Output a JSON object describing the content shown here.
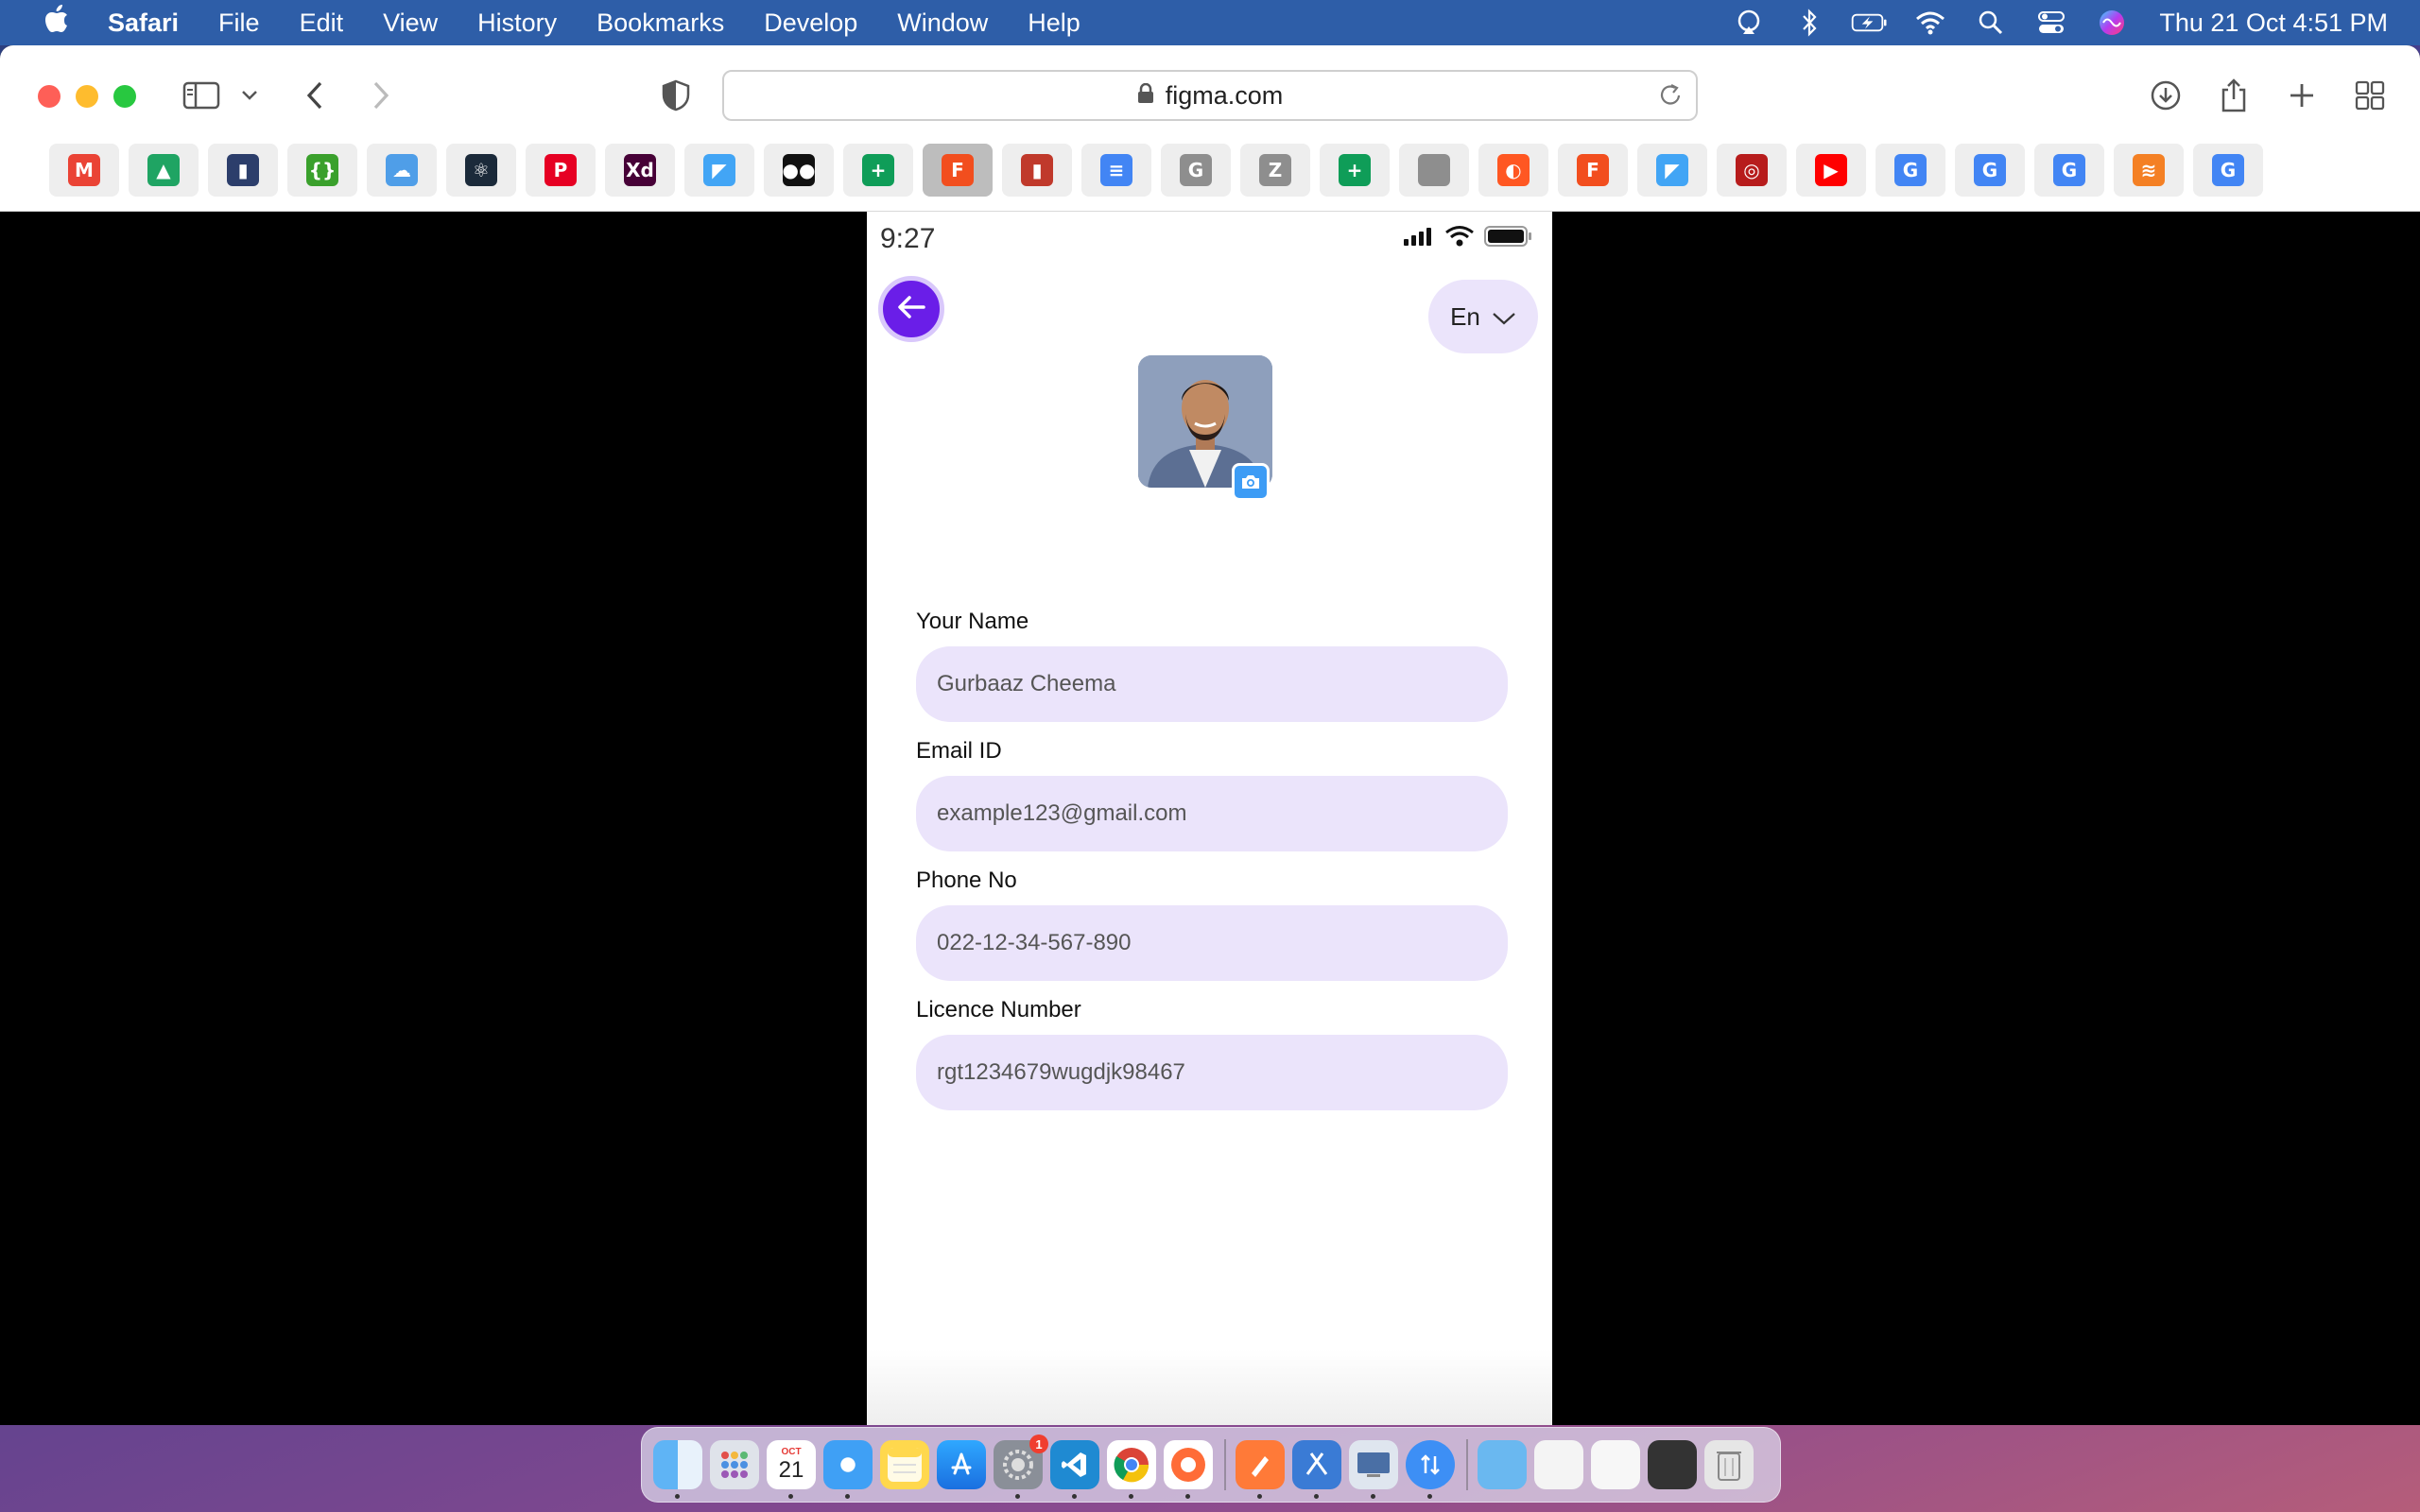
{
  "menubar": {
    "app_name": "Safari",
    "menus": [
      "File",
      "Edit",
      "View",
      "History",
      "Bookmarks",
      "Develop",
      "Window",
      "Help"
    ],
    "clock": "Thu 21 Oct  4:51 PM",
    "status_icons": [
      "airplay-icon",
      "bluetooth-icon",
      "battery-charging-icon",
      "wifi-icon",
      "spotlight-search-icon",
      "control-center-icon",
      "siri-icon"
    ]
  },
  "browser": {
    "url": "figma.com",
    "favorites": [
      {
        "name": "gmail",
        "glyph": "M",
        "color": "#ea4335"
      },
      {
        "name": "google-drive",
        "glyph": "▲",
        "color": "#1fa463"
      },
      {
        "name": "bookmark-app",
        "glyph": "▮",
        "color": "#2c3e6b"
      },
      {
        "name": "api-tool",
        "glyph": "{}",
        "color": "#3aa02c"
      },
      {
        "name": "icloud",
        "glyph": "☁",
        "color": "#4f9ee8"
      },
      {
        "name": "react",
        "glyph": "⚛",
        "color": "#1b2a3a"
      },
      {
        "name": "pinterest",
        "glyph": "P",
        "color": "#e60023"
      },
      {
        "name": "adobe-xd",
        "glyph": "Xd",
        "color": "#470137"
      },
      {
        "name": "flutter",
        "glyph": "◤",
        "color": "#42a5f5"
      },
      {
        "name": "medium",
        "glyph": "●●",
        "color": "#111111"
      },
      {
        "name": "google-sheets",
        "glyph": "+",
        "color": "#0f9d58"
      },
      {
        "name": "figma",
        "glyph": "F",
        "color": "#f24e1e"
      },
      {
        "name": "analytics",
        "glyph": "▮",
        "color": "#c0392b"
      },
      {
        "name": "google-docs",
        "glyph": "≡",
        "color": "#4285f4"
      },
      {
        "name": "g-grey",
        "glyph": "G",
        "color": "#8e8e8e"
      },
      {
        "name": "z-grey",
        "glyph": "Z",
        "color": "#8e8e8e"
      },
      {
        "name": "google-sheets-2",
        "glyph": "+",
        "color": "#0f9d58"
      },
      {
        "name": "apple",
        "glyph": "",
        "color": "#8e8e8e"
      },
      {
        "name": "colorful-app",
        "glyph": "◐",
        "color": "#ff5722"
      },
      {
        "name": "figma-2",
        "glyph": "F",
        "color": "#f24e1e"
      },
      {
        "name": "flutter-2",
        "glyph": "◤",
        "color": "#42a5f5"
      },
      {
        "name": "circle-app",
        "glyph": "◎",
        "color": "#b71c1c"
      },
      {
        "name": "youtube",
        "glyph": "▶",
        "color": "#ff0000"
      },
      {
        "name": "google-1",
        "glyph": "G",
        "color": "#4285f4"
      },
      {
        "name": "google-2",
        "glyph": "G",
        "color": "#4285f4"
      },
      {
        "name": "google-3",
        "glyph": "G",
        "color": "#4285f4"
      },
      {
        "name": "stack-overflow",
        "glyph": "≋",
        "color": "#f48024"
      },
      {
        "name": "google-4",
        "glyph": "G",
        "color": "#4285f4"
      }
    ],
    "active_favorite_index": 11
  },
  "app": {
    "status_time": "9:27",
    "language": "En",
    "form": {
      "name_label": "Your Name",
      "name_value": "Gurbaaz Cheema",
      "email_label": "Email ID",
      "email_value": "example123@gmail.com",
      "phone_label": "Phone No",
      "phone_value": "022-12-34-567-890",
      "licence_label": "Licence Number",
      "licence_value": "rgt1234679wugdjk98467"
    },
    "colors": {
      "accent": "#6a1ee8",
      "input_bg": "#ebe4fb",
      "camera_badge": "#3d9cf5"
    }
  },
  "dock": {
    "calendar_month": "OCT",
    "calendar_day": "21",
    "settings_badge": "1"
  }
}
